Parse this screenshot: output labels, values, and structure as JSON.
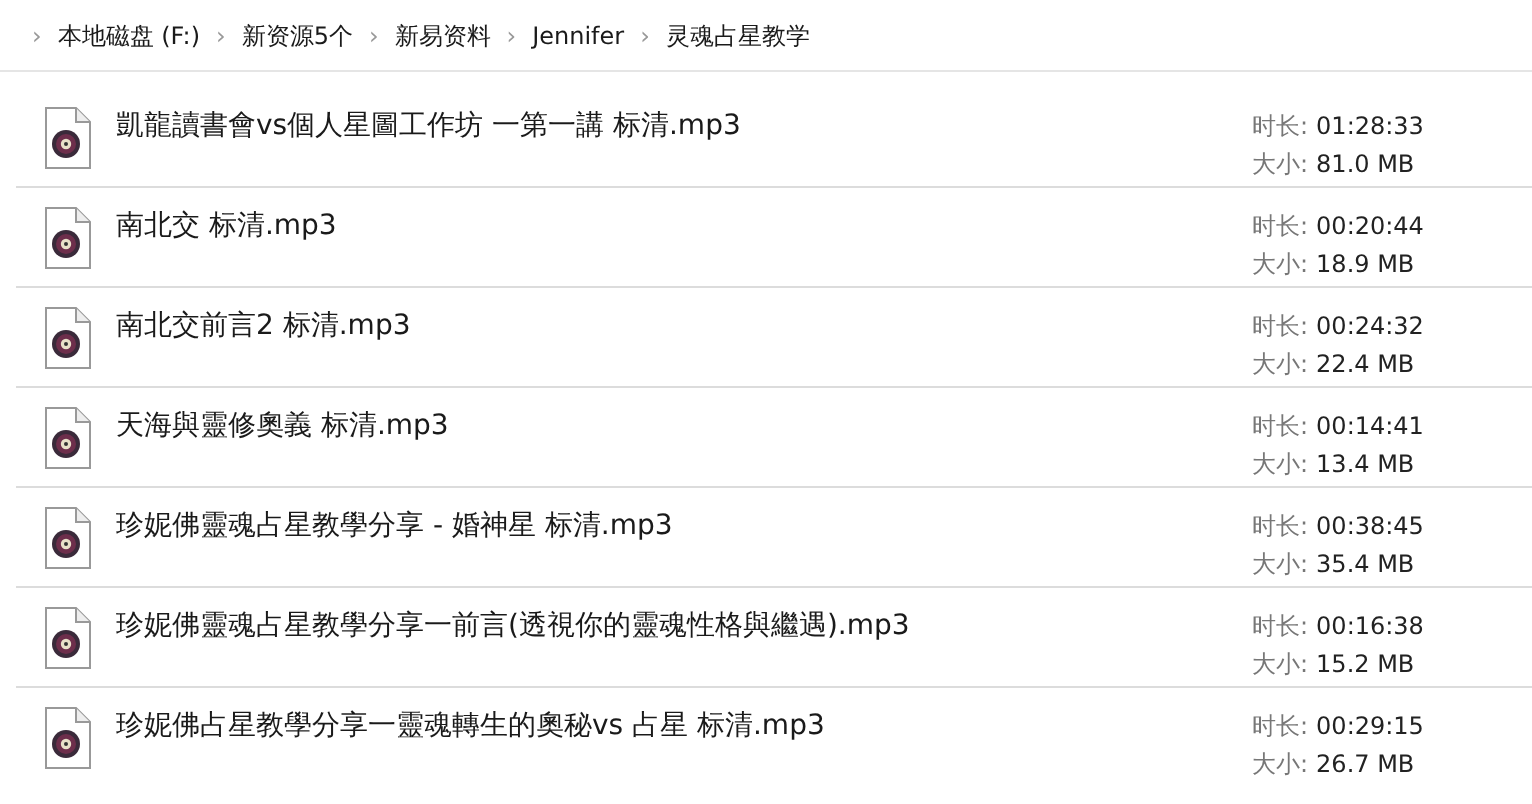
{
  "breadcrumb": [
    "本地磁盘 (F:)",
    "新资源5个",
    "新易资料",
    "Jennifer",
    "灵魂占星教学"
  ],
  "breadcrumb_separator": "›",
  "files": [
    {
      "name": "凱龍讀書會vs個人星圖工作坊 一第一講 标清.mp3",
      "duration_label": "时长:",
      "duration": "01:28:33",
      "size_label": "大小:",
      "size": "81.0 MB"
    },
    {
      "name": "南北交 标清.mp3",
      "duration_label": "时长:",
      "duration": "00:20:44",
      "size_label": "大小:",
      "size": "18.9 MB"
    },
    {
      "name": "南北交前言2 标清.mp3",
      "duration_label": "时长:",
      "duration": "00:24:32",
      "size_label": "大小:",
      "size": "22.4 MB"
    },
    {
      "name": "天海與靈修奧義 标清.mp3",
      "duration_label": "时长:",
      "duration": "00:14:41",
      "size_label": "大小:",
      "size": "13.4 MB"
    },
    {
      "name": "珍妮佛靈魂占星教學分享 - 婚神星 标清.mp3",
      "duration_label": "时长:",
      "duration": "00:38:45",
      "size_label": "大小:",
      "size": "35.4 MB"
    },
    {
      "name": "珍妮佛靈魂占星教學分享一前言(透視你的靈魂性格與繼遇).mp3",
      "duration_label": "时长:",
      "duration": "00:16:38",
      "size_label": "大小:",
      "size": "15.2 MB"
    },
    {
      "name": "珍妮佛占星教學分享一靈魂轉生的奧秘vs 占星 标清.mp3",
      "duration_label": "时长:",
      "duration": "00:29:15",
      "size_label": "大小:",
      "size": "26.7 MB"
    }
  ]
}
